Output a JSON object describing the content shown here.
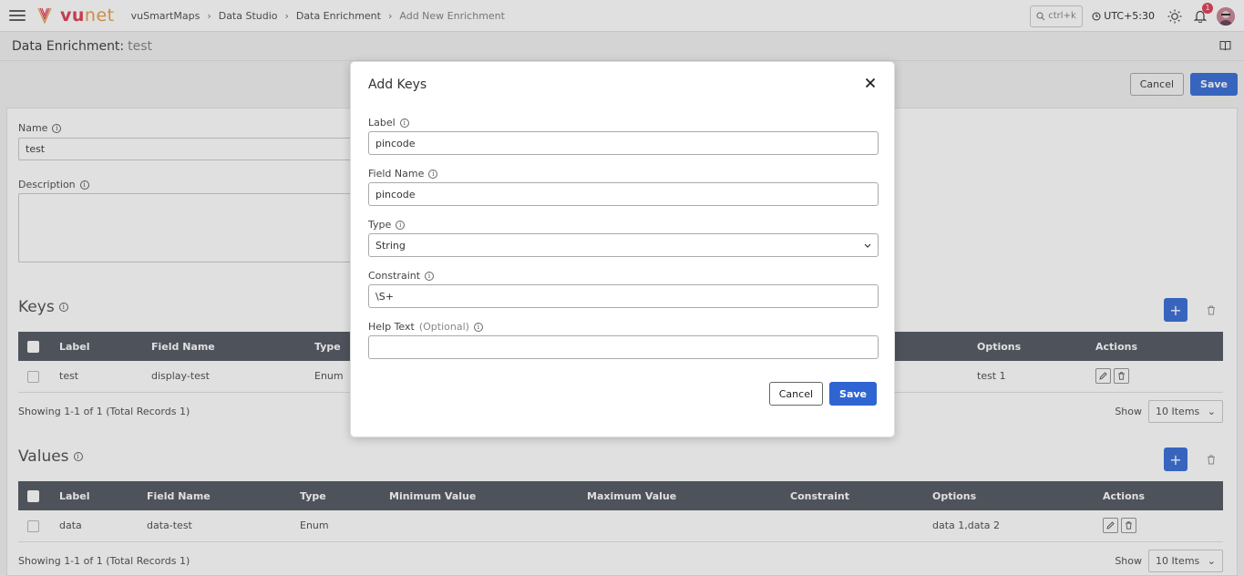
{
  "topbar": {
    "logo_vu": "vu",
    "logo_net": "net",
    "breadcrumbs": [
      "vuSmartMaps",
      "Data Studio",
      "Data Enrichment",
      "Add New Enrichment"
    ],
    "search_placeholder": "ctrl+k",
    "timezone": "UTC+5:30",
    "notification_count": "1"
  },
  "subheader": {
    "title": "Data Enrichment:",
    "name": "test"
  },
  "page_actions": {
    "cancel": "Cancel",
    "save": "Save"
  },
  "form": {
    "name_label": "Name",
    "name_value": "test",
    "description_label": "Description",
    "description_value": ""
  },
  "keys": {
    "title": "Keys",
    "columns": [
      "Label",
      "Field Name",
      "Type",
      "Options",
      "Actions"
    ],
    "rows": [
      {
        "label": "test",
        "field_name": "display-test",
        "type": "Enum",
        "options": "test 1"
      }
    ],
    "showing": "Showing 1-1 of 1 (Total Records 1)",
    "show_label": "Show",
    "items": "10 Items"
  },
  "values": {
    "title": "Values",
    "columns": [
      "Label",
      "Field Name",
      "Type",
      "Minimum Value",
      "Maximum Value",
      "Constraint",
      "Options",
      "Actions"
    ],
    "rows": [
      {
        "label": "data",
        "field_name": "data-test",
        "type": "Enum",
        "min": "",
        "max": "",
        "constraint": "",
        "options": "data 1,data 2"
      }
    ],
    "showing": "Showing 1-1 of 1 (Total Records 1)",
    "show_label": "Show",
    "items": "10 Items"
  },
  "modal": {
    "title": "Add Keys",
    "label_label": "Label",
    "label_value": "pincode",
    "field_name_label": "Field Name",
    "field_name_value": "pincode",
    "type_label": "Type",
    "type_value": "String",
    "constraint_label": "Constraint",
    "constraint_value": "\\S+",
    "help_text_label": "Help Text",
    "help_text_optional": "(Optional)",
    "help_text_value": "",
    "cancel": "Cancel",
    "save": "Save"
  },
  "colors": {
    "primary": "#3f74d9",
    "table_header": "#595f68",
    "brand_red": "#e0455a",
    "brand_orange": "#e7a24f"
  }
}
